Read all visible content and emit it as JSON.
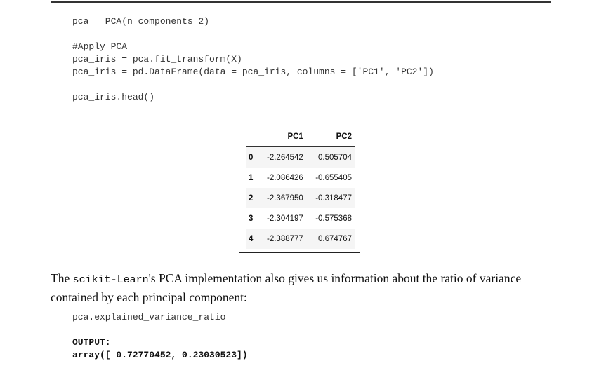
{
  "code1": {
    "lines": [
      "pca = PCA(n_components=2)",
      "#Apply PCA",
      "pca_iris = pca.fit_transform(X)",
      "pca_iris = pd.DataFrame(data = pca_iris, columns = ['PC1', 'PC2'])",
      "pca_iris.head()"
    ]
  },
  "table": {
    "headers": [
      "",
      "PC1",
      "PC2"
    ],
    "rows": [
      [
        "0",
        "-2.264542",
        "0.505704"
      ],
      [
        "1",
        "-2.086426",
        "-0.655405"
      ],
      [
        "2",
        "-2.367950",
        "-0.318477"
      ],
      [
        "3",
        "-2.304197",
        "-0.575368"
      ],
      [
        "4",
        "-2.388777",
        "0.674767"
      ]
    ]
  },
  "paragraph": {
    "pre": "The ",
    "code": "scikit-Learn",
    "post": "'s PCA implementation also gives us information about the ratio of variance contained by each principal component:"
  },
  "code2": {
    "line": "pca.explained_variance_ratio",
    "output_label": "OUTPUT:",
    "output_value": "array([ 0.72770452, 0.23030523])"
  }
}
